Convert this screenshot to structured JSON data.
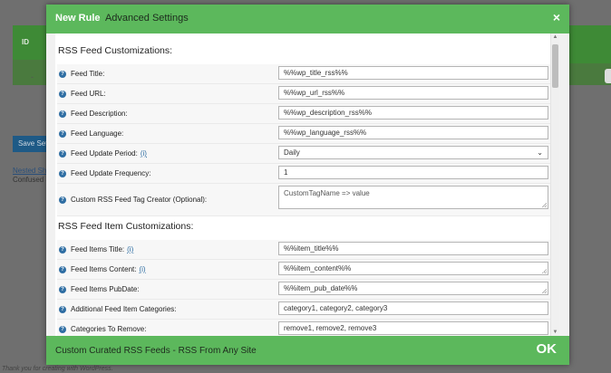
{
  "background": {
    "table_id_label": "ID",
    "row_dash": "-",
    "save_button": "Save Sett",
    "link": "Nested Sho",
    "text": "Confused a",
    "footer": "Thank you for creating with WordPress."
  },
  "modal": {
    "title_strong": "New Rule",
    "title_rest": "Advanced Settings",
    "close_label": "×",
    "footer_text": "Custom Curated RSS Feeds - RSS From Any Site",
    "ok_label": "OK"
  },
  "sections": {
    "feed_title": "RSS Feed Customizations:",
    "item_title": "RSS Feed Item Customizations:"
  },
  "feed_rows": [
    {
      "label": "Feed Title:",
      "info": "",
      "value": "%%wp_title_rss%%",
      "type": "text"
    },
    {
      "label": "Feed URL:",
      "info": "",
      "value": "%%wp_url_rss%%",
      "type": "text"
    },
    {
      "label": "Feed Description:",
      "info": "",
      "value": "%%wp_description_rss%%",
      "type": "text"
    },
    {
      "label": "Feed Language:",
      "info": "",
      "value": "%%wp_language_rss%%",
      "type": "text"
    },
    {
      "label": "Feed Update Period:",
      "info": "(i)",
      "value": "Daily",
      "type": "select"
    },
    {
      "label": "Feed Update Frequency:",
      "info": "",
      "value": "1",
      "type": "text"
    },
    {
      "label": "Custom RSS Feed Tag Creator (Optional):",
      "info": "",
      "value": "",
      "placeholder": "CustomTagName => value",
      "type": "textarea"
    }
  ],
  "item_rows": [
    {
      "label": "Feed Items Title:",
      "info": "(i)",
      "value": "%%item_title%%",
      "type": "text"
    },
    {
      "label": "Feed Items Content:",
      "info": "(i)",
      "value": "%%item_content%%",
      "type": "textarea-short"
    },
    {
      "label": "Feed Items PubDate:",
      "info": "",
      "value": "%%item_pub_date%%",
      "type": "textarea-short"
    },
    {
      "label": "Additional Feed Item Categories:",
      "info": "",
      "value": "",
      "placeholder": "category1, category2, category3",
      "type": "text"
    },
    {
      "label": "Categories To Remove:",
      "info": "",
      "value": "",
      "placeholder": "remove1, remove2, remove3",
      "type": "text"
    }
  ],
  "colors": {
    "header_green": "#5cb85c",
    "help_icon_blue": "#2f6ea3"
  }
}
